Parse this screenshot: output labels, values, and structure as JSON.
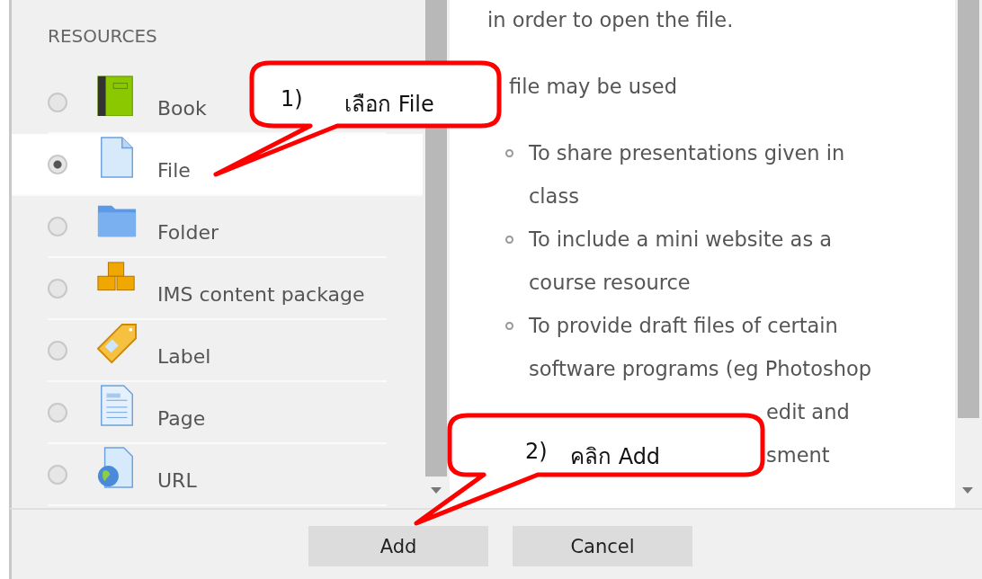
{
  "resources": {
    "heading": "RESOURCES",
    "items": [
      {
        "label": "Book",
        "kind": "book",
        "selected": false
      },
      {
        "label": "File",
        "kind": "file",
        "selected": true
      },
      {
        "label": "Folder",
        "kind": "folder",
        "selected": false
      },
      {
        "label": "IMS content package",
        "kind": "package",
        "selected": false
      },
      {
        "label": "Label",
        "kind": "label",
        "selected": false
      },
      {
        "label": "Page",
        "kind": "page",
        "selected": false
      },
      {
        "label": "URL",
        "kind": "url",
        "selected": false
      }
    ]
  },
  "description": {
    "intro": "in order to open the file.",
    "usage": "file may be used",
    "bullets": [
      {
        "text": "To share presentations given in class"
      },
      {
        "text": "To include a mini website as a course resource"
      },
      {
        "text": "To provide draft files of certain software programs (eg Photoshop",
        "fragments": [
          "edit and",
          "sment"
        ]
      }
    ]
  },
  "buttons": [
    "Add",
    "Cancel"
  ],
  "callouts": [
    {
      "number": "1)",
      "text": "เลือก File"
    },
    {
      "number": "2)",
      "text": "คลิก Add"
    }
  ]
}
